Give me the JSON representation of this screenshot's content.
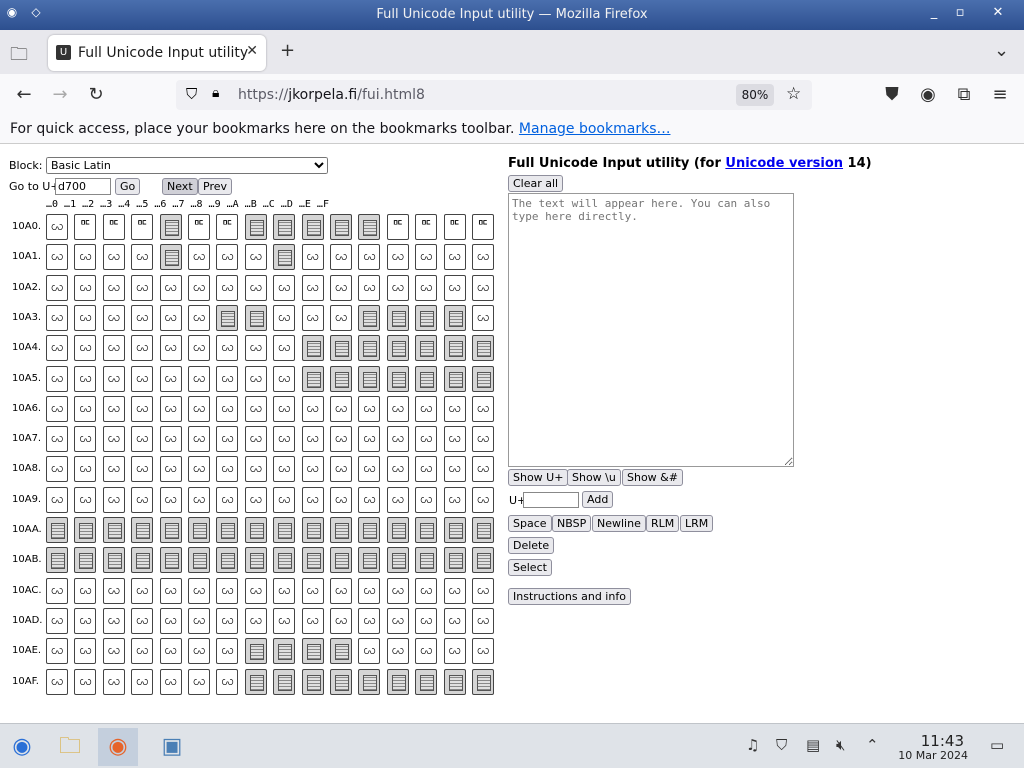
{
  "window": {
    "title": "Full Unicode Input utility — Mozilla Firefox"
  },
  "browser": {
    "tab_label": "Full Unicode Input utility",
    "url_prefix": "https://",
    "url_host": "jkorpela.fi",
    "url_path": "/fui.html8",
    "zoom": "80%",
    "bookmarks_message": "For quick access, place your bookmarks here on the bookmarks toolbar.",
    "bookmarks_link": "Manage bookmarks…"
  },
  "page": {
    "block_label": "Block:",
    "block_selected": "Basic Latin",
    "goto_label": "Go to U+",
    "goto_value": "d700",
    "go_button": "Go",
    "next_button": "Next",
    "prev_button": "Prev",
    "grid_header": "…0 …1 …2 …3 …4 …5 …6 …7 …8 …9 …A …B …C …D …E …F",
    "title_prefix": "Full Unicode Input utility (for ",
    "title_link": "Unicode version",
    "title_suffix": " 14)",
    "clear_all": "Clear all",
    "textarea_placeholder": "The text will appear here. You can also type here directly.",
    "show_uplus": "Show U+",
    "show_u": "Show \\u",
    "show_amp": "Show &#",
    "uplus_label": "U+",
    "add_button": "Add",
    "space_button": "Space",
    "nbsp_button": "NBSP",
    "newline_button": "Newline",
    "rlm_button": "RLM",
    "lrm_button": "LRM",
    "delete_button": "Delete",
    "select_button": "Select",
    "instructions_button": "Instructions and info"
  },
  "grid": {
    "rows": [
      {
        "label": "10A0.",
        "cells": [
          "ꩬ",
          "ꥰ",
          "ꥰ",
          "ꥰ",
          "#",
          "ꥰ",
          "ꥰ",
          "#",
          "#",
          "#",
          "#",
          "#",
          "ꥰ",
          "ꥰ",
          "ꥰ",
          "ꥰ"
        ]
      },
      {
        "label": "10A1.",
        "cells": [
          "ꩬ",
          "ꩬ",
          "ꩬ",
          "ꩬ",
          "#",
          "ꩬ",
          "ꩬ",
          "ꩬ",
          "#",
          "ꩬ",
          "ꩬ",
          "ꩬ",
          "ꩬ",
          "ꩬ",
          "ꩬ",
          "ꩬ"
        ]
      },
      {
        "label": "10A2.",
        "cells": [
          "ꩬ",
          "ꩬ",
          "ꩬ",
          "ꩬ",
          "ꩬ",
          "ꩬ",
          "ꩬ",
          "ꩬ",
          "ꩬ",
          "ꩬ",
          "ꩬ",
          "ꩬ",
          "ꩬ",
          "ꩬ",
          "ꩬ",
          "ꩬ"
        ]
      },
      {
        "label": "10A3.",
        "cells": [
          "ꩬ",
          "ꩬ",
          "ꩬ",
          "ꩬ",
          "ꩬ",
          "ꩬ",
          "#",
          "#",
          "ꩬ",
          "ꩬ",
          "ꩬ",
          "#",
          "#",
          "#",
          "#",
          "ꩬ"
        ]
      },
      {
        "label": "10A4.",
        "cells": [
          "ꩬ",
          "ꩬ",
          "ꩬ",
          "ꩬ",
          "ꩬ",
          "ꩬ",
          "ꩬ",
          "ꩬ",
          "ꩬ",
          "#",
          "#",
          "#",
          "#",
          "#",
          "#",
          "#"
        ]
      },
      {
        "label": "10A5.",
        "cells": [
          "ꩬ",
          "ꩬ",
          "ꩬ",
          "ꩬ",
          "ꩬ",
          "ꩬ",
          "ꩬ",
          "ꩬ",
          "ꩬ",
          "#",
          "#",
          "#",
          "#",
          "#",
          "#",
          "#"
        ]
      },
      {
        "label": "10A6.",
        "cells": [
          "ꩬ",
          "ꩬ",
          "ꩬ",
          "ꩬ",
          "ꩬ",
          "ꩬ",
          "ꩬ",
          "ꩬ",
          "ꩬ",
          "ꩬ",
          "ꩬ",
          "ꩬ",
          "ꩬ",
          "ꩬ",
          "ꩬ",
          "ꩬ"
        ]
      },
      {
        "label": "10A7.",
        "cells": [
          "ꩬ",
          "ꩬ",
          "ꩬ",
          "ꩬ",
          "ꩬ",
          "ꩬ",
          "ꩬ",
          "ꩬ",
          "ꩬ",
          "ꩬ",
          "ꩬ",
          "ꩬ",
          "ꩬ",
          "ꩬ",
          "ꩬ",
          "ꩬ"
        ]
      },
      {
        "label": "10A8.",
        "cells": [
          "ꩬ",
          "ꩬ",
          "ꩬ",
          "ꩬ",
          "ꩬ",
          "ꩬ",
          "ꩬ",
          "ꩬ",
          "ꩬ",
          "ꩬ",
          "ꩬ",
          "ꩬ",
          "ꩬ",
          "ꩬ",
          "ꩬ",
          "ꩬ"
        ]
      },
      {
        "label": "10A9.",
        "cells": [
          "ꩬ",
          "ꩬ",
          "ꩬ",
          "ꩬ",
          "ꩬ",
          "ꩬ",
          "ꩬ",
          "ꩬ",
          "ꩬ",
          "ꩬ",
          "ꩬ",
          "ꩬ",
          "ꩬ",
          "ꩬ",
          "ꩬ",
          "ꩬ"
        ]
      },
      {
        "label": "10AA.",
        "cells": [
          "#",
          "#",
          "#",
          "#",
          "#",
          "#",
          "#",
          "#",
          "#",
          "#",
          "#",
          "#",
          "#",
          "#",
          "#",
          "#"
        ]
      },
      {
        "label": "10AB.",
        "cells": [
          "#",
          "#",
          "#",
          "#",
          "#",
          "#",
          "#",
          "#",
          "#",
          "#",
          "#",
          "#",
          "#",
          "#",
          "#",
          "#"
        ]
      },
      {
        "label": "10AC.",
        "cells": [
          "ꩬ",
          "ꩬ",
          "ꩬ",
          "ꩬ",
          "ꩬ",
          "ꩬ",
          "ꩬ",
          "ꩬ",
          "ꩬ",
          "ꩬ",
          "ꩬ",
          "ꩬ",
          "ꩬ",
          "ꩬ",
          "ꩬ",
          "ꩬ"
        ]
      },
      {
        "label": "10AD.",
        "cells": [
          "ꩬ",
          "ꩬ",
          "ꩬ",
          "ꩬ",
          "ꩬ",
          "ꩬ",
          "ꩬ",
          "ꩬ",
          "ꩬ",
          "ꩬ",
          "ꩬ",
          "ꩬ",
          "ꩬ",
          "ꩬ",
          "ꩬ",
          "ꩬ"
        ]
      },
      {
        "label": "10AE.",
        "cells": [
          "ꩬ",
          "ꩬ",
          "ꩬ",
          "ꩬ",
          "ꩬ",
          "ꩬ",
          "ꩬ",
          "#",
          "#",
          "#",
          "#",
          "ꩬ",
          "ꩬ",
          "ꩬ",
          "ꩬ",
          "ꩬ"
        ]
      },
      {
        "label": "10AF.",
        "cells": [
          "ꩬ",
          "ꩬ",
          "ꩬ",
          "ꩬ",
          "ꩬ",
          "ꩬ",
          "ꩬ",
          "#",
          "#",
          "#",
          "#",
          "#",
          "#",
          "#",
          "#",
          "#"
        ]
      }
    ]
  },
  "taskbar": {
    "time": "11:43",
    "date": "10 Mar 2024"
  }
}
